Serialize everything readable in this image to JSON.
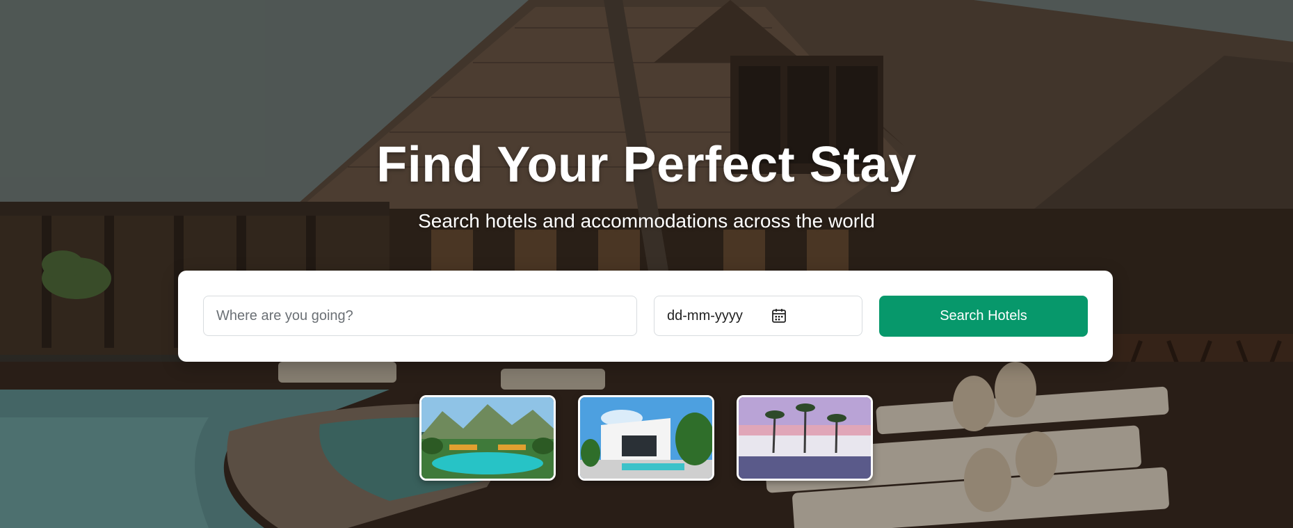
{
  "hero": {
    "title": "Find Your Perfect Stay",
    "subtitle": "Search hotels and accommodations across the world"
  },
  "search": {
    "destination_placeholder": "Where are you going?",
    "destination_value": "",
    "date_placeholder": "dd-mm-yyyy",
    "date_icon": "calendar-icon",
    "button_label": "Search Hotels"
  },
  "colors": {
    "accent": "#07986b",
    "card_bg": "#ffffff",
    "text_light": "#ffffff"
  },
  "thumbnails": [
    {
      "scene": "tropical-pool-resort"
    },
    {
      "scene": "modern-white-villa"
    },
    {
      "scene": "sunset-palm-resort"
    }
  ]
}
